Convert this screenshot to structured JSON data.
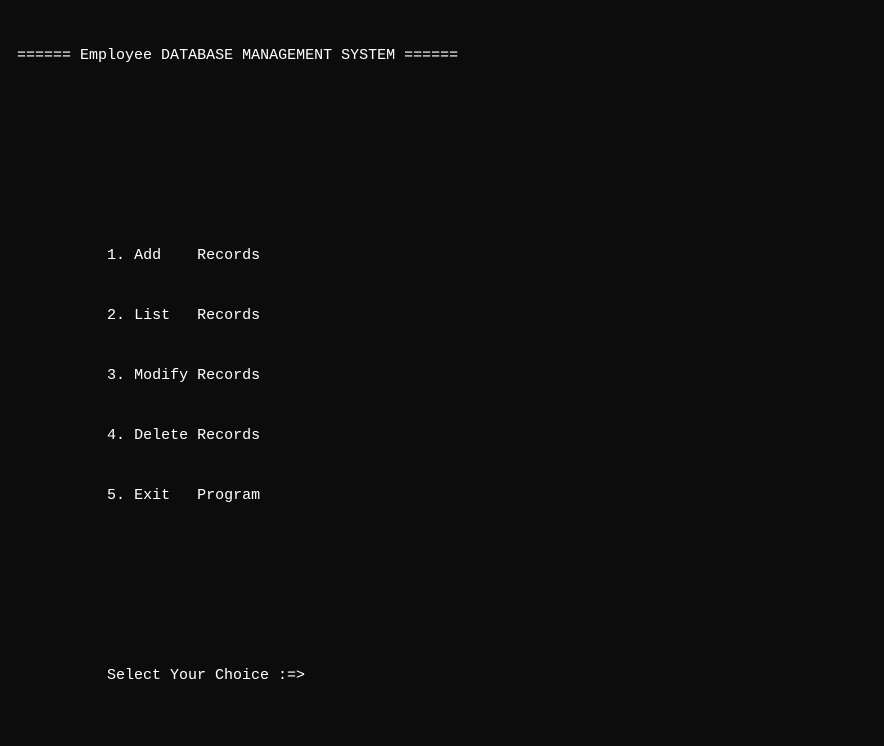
{
  "title": {
    "left_decor": "======",
    "text": "Employee DATABASE MANAGEMENT SYSTEM",
    "right_decor": "======"
  },
  "menu": {
    "items": [
      {
        "num": "1.",
        "action": "Add",
        "object": "Records"
      },
      {
        "num": "2.",
        "action": "List",
        "object": "Records"
      },
      {
        "num": "3.",
        "action": "Modify",
        "object": "Records"
      },
      {
        "num": "4.",
        "action": "Delete",
        "object": "Records"
      },
      {
        "num": "5.",
        "action": "Exit",
        "object": "Program"
      }
    ]
  },
  "prompt": {
    "label": "Select Your Choice :=>"
  }
}
